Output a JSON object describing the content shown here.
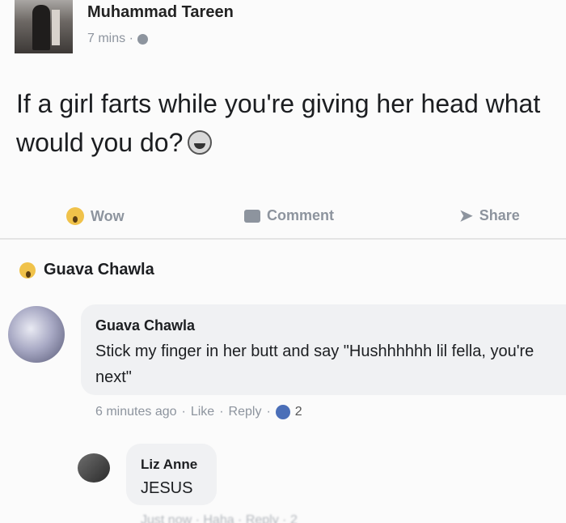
{
  "post": {
    "author": "Muhammad Tareen",
    "time": "7 mins ·",
    "text": "If a girl farts while you're giving her head what would you do?",
    "emoji": "laughing-crying-emoji"
  },
  "actions": {
    "wow": "Wow",
    "comment": "Comment",
    "share": "Share"
  },
  "reactions": {
    "summary_name": "Guava Chawla"
  },
  "comments": [
    {
      "name": "Guava Chawla",
      "text": "Stick my finger in her butt and say \"Hushhhhhh lil fella, you're next\"",
      "time": "6 minutes ago",
      "like": "Like",
      "reply": "Reply",
      "likes": "2"
    },
    {
      "name": "Liz Anne",
      "text": "JESUS",
      "meta": "Just now · Haha · Reply · 2"
    }
  ],
  "colors": {
    "muted": "#8d949e",
    "bubble": "#f0f1f3",
    "like_blue": "#4b6fb8",
    "wow_yellow": "#f0c24a"
  }
}
